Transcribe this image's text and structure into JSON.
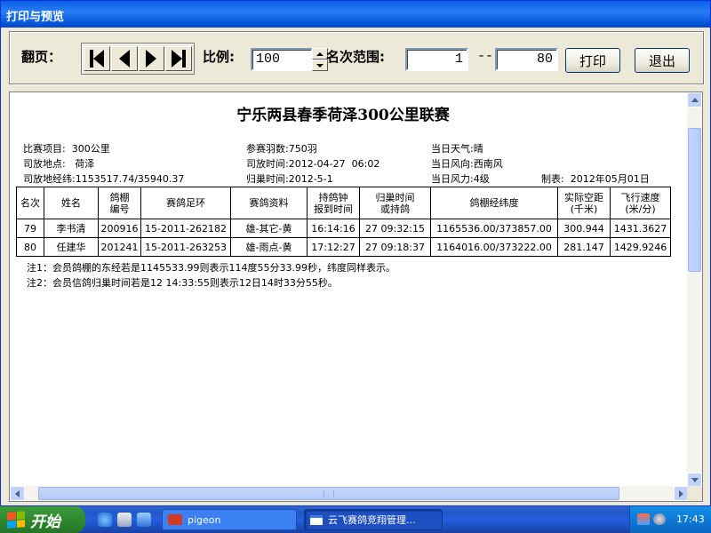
{
  "window": {
    "title": "打印与预览"
  },
  "toolbar": {
    "page_label": "翻页：",
    "scale_label": "比例:",
    "scale_value": "100",
    "range_label": "名次范围:",
    "range_from": "1",
    "range_sep": "---",
    "range_to": "80",
    "print_label": "打印",
    "exit_label": "退出"
  },
  "report": {
    "title": "宁乐两县春季荷泽300公里联赛",
    "info": {
      "project_label": "比赛项目:",
      "project": "300公里",
      "birds_label": "参赛羽数:",
      "birds": "750羽",
      "weather_label": "当日天气:",
      "weather": "晴",
      "release_place_label": "司放地点:",
      "release_place": "荷泽",
      "release_time_label": "司放时间:",
      "release_time": "2012-04-27  06:02",
      "wind_dir_label": "当日风向:",
      "wind_dir": "西南风",
      "coords_label": "司放地经纬:",
      "coords": "1153517.74/35940.37",
      "return_time_label": "归巢时间:",
      "return_time": "2012-5-1",
      "wind_power_label": "当日风力:",
      "wind_power": "4级",
      "made_label": "制表:",
      "made_date": "2012年05月01日"
    },
    "columns": [
      {
        "l1": "名次",
        "l2": ""
      },
      {
        "l1": "姓名",
        "l2": ""
      },
      {
        "l1": "鸽棚",
        "l2": "编号"
      },
      {
        "l1": "赛鸽足环",
        "l2": ""
      },
      {
        "l1": "赛鸽资料",
        "l2": ""
      },
      {
        "l1": "持鸽钟",
        "l2": "报到时间"
      },
      {
        "l1": "归巢时间",
        "l2": "或持鸽"
      },
      {
        "l1": "鸽棚经纬度",
        "l2": ""
      },
      {
        "l1": "实际空距",
        "l2": "(千米)"
      },
      {
        "l1": "飞行速度",
        "l2": "(米/分)"
      }
    ],
    "rows": [
      [
        "79",
        "李书清",
        "200916",
        "15-2011-262182",
        "雄-其它-黄",
        "16:14:16",
        "27 09:32:15",
        "1165536.00/373857.00",
        "300.944",
        "1431.3627"
      ],
      [
        "80",
        "任建华",
        "201241",
        "15-2011-263253",
        "雄-雨点-黄",
        "17:12:27",
        "27 09:18:37",
        "1164016.00/373222.00",
        "281.147",
        "1429.9246"
      ]
    ],
    "notes": [
      "注1：会员鸽棚的东经若是1145533.99则表示114度55分33.99秒，纬度同样表示。",
      "注2：会员信鸽归巢时间若是12 14:33:55则表示12日14时33分55秒。"
    ]
  },
  "taskbar": {
    "start_label": "开始",
    "tasks": [
      {
        "label": "pigeon",
        "icon": "pigeon-app-icon"
      },
      {
        "label": "云飞赛鸽竞翔管理...",
        "icon": "window-icon"
      }
    ],
    "clock": "17:43"
  },
  "colors": {
    "titlebar": "#0a5fe8",
    "taskbar": "#245edb",
    "start": "#3c9a3c",
    "window_bg": "#ece9d8"
  }
}
